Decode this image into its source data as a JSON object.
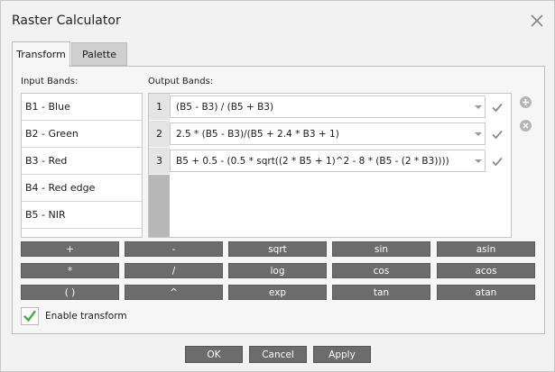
{
  "window": {
    "title": "Raster Calculator"
  },
  "tabs": [
    {
      "label": "Transform",
      "active": true
    },
    {
      "label": "Palette",
      "active": false
    }
  ],
  "input_bands": {
    "label": "Input Bands:",
    "items": [
      "B1 - Blue",
      "B2 - Green",
      "B3 - Red",
      "B4 - Red edge",
      "B5 - NIR"
    ]
  },
  "output_bands": {
    "label": "Output Bands:",
    "rows": [
      {
        "num": "1",
        "expression": "(B5 - B3) / (B5 + B3)"
      },
      {
        "num": "2",
        "expression": "2.5 * (B5 - B3)/(B5 + 2.4 * B3 + 1)"
      },
      {
        "num": "3",
        "expression": "B5 + 0.5 - (0.5 * sqrt((2 * B5 + 1)^2 - 8 * (B5 - (2 * B3))))"
      }
    ]
  },
  "keypad": [
    [
      "+",
      "-",
      "sqrt",
      "sin",
      "asin"
    ],
    [
      "*",
      "/",
      "log",
      "cos",
      "acos"
    ],
    [
      "( )",
      "^",
      "exp",
      "tan",
      "atan"
    ]
  ],
  "enable_transform": {
    "label": "Enable transform",
    "checked": true
  },
  "footer": {
    "ok": "OK",
    "cancel": "Cancel",
    "apply": "Apply"
  },
  "colors": {
    "key_bg": "#6c6c6c",
    "check_green": "#3cb43c",
    "gutter": "#b7b7b7"
  }
}
